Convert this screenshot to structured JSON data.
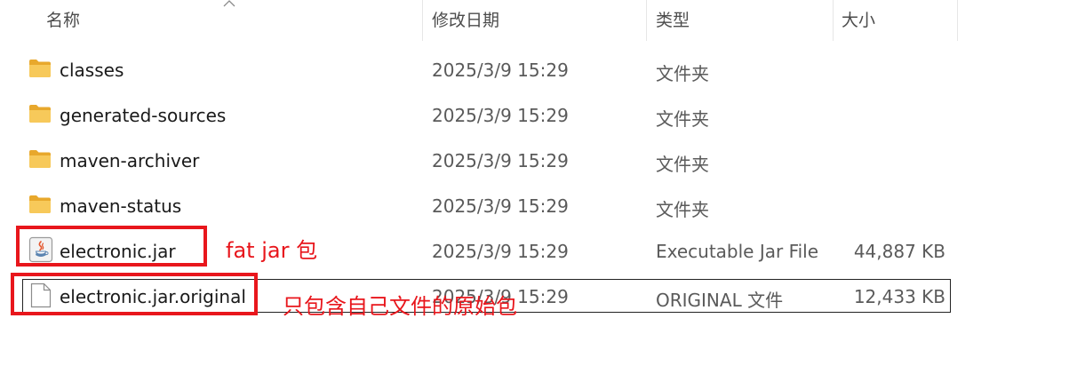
{
  "columns": {
    "name": "名称",
    "modified": "修改日期",
    "type": "类型",
    "size": "大小"
  },
  "files": [
    {
      "name": "classes",
      "date": "2025/3/9 15:29",
      "type": "文件夹",
      "size": "",
      "icon": "folder-icon"
    },
    {
      "name": "generated-sources",
      "date": "2025/3/9 15:29",
      "type": "文件夹",
      "size": "",
      "icon": "folder-icon"
    },
    {
      "name": "maven-archiver",
      "date": "2025/3/9 15:29",
      "type": "文件夹",
      "size": "",
      "icon": "folder-icon"
    },
    {
      "name": "maven-status",
      "date": "2025/3/9 15:29",
      "type": "文件夹",
      "size": "",
      "icon": "folder-icon"
    },
    {
      "name": "electronic.jar",
      "date": "2025/3/9 15:29",
      "type": "Executable Jar File",
      "size": "44,887 KB",
      "icon": "java-jar-icon"
    },
    {
      "name": "electronic.jar.original",
      "date": "2025/3/9 15:29",
      "type": "ORIGINAL 文件",
      "size": "12,433 KB",
      "icon": "file-icon"
    }
  ],
  "annotations": {
    "fat_jar": "fat jar 包",
    "original": "只包含自己文件的原始包"
  },
  "colors": {
    "annotation": "#e8161c",
    "folder": "#f4c24f",
    "header_text": "#4c4c4c",
    "secondary_text": "#5a5a5a"
  }
}
